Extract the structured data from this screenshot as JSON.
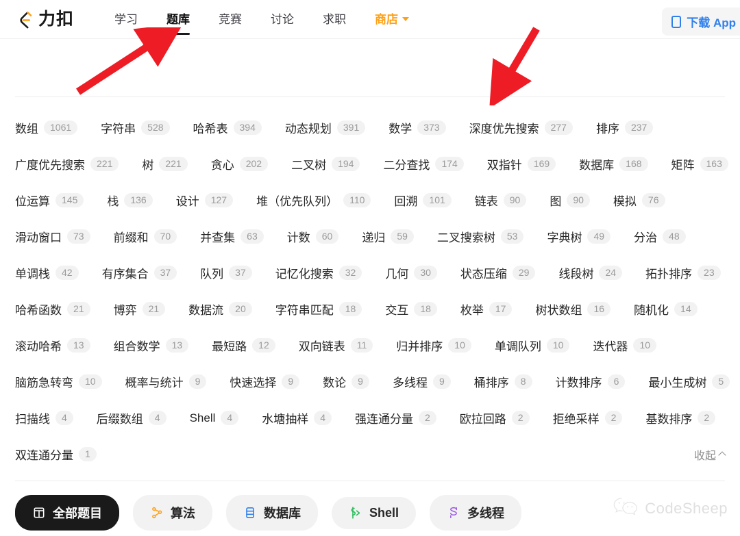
{
  "header": {
    "brand_name": "力扣",
    "brand_logo_icon": "leetcode-logo-icon",
    "nav": [
      {
        "label": "学习",
        "active": false
      },
      {
        "label": "题库",
        "active": true
      },
      {
        "label": "竞赛",
        "active": false
      },
      {
        "label": "讨论",
        "active": false
      },
      {
        "label": "求职",
        "active": false
      }
    ],
    "shop": {
      "label": "商店",
      "icon": "chevron-down-icon"
    },
    "download": {
      "label": "下载 App",
      "icon": "phone-icon",
      "color": "#2f80ed"
    }
  },
  "tags": {
    "rows": [
      [
        {
          "label": "数组",
          "count": "1061"
        },
        {
          "label": "字符串",
          "count": "528"
        },
        {
          "label": "哈希表",
          "count": "394"
        },
        {
          "label": "动态规划",
          "count": "391"
        },
        {
          "label": "数学",
          "count": "373"
        },
        {
          "label": "深度优先搜索",
          "count": "277"
        },
        {
          "label": "排序",
          "count": "237"
        }
      ],
      [
        {
          "label": "广度优先搜索",
          "count": "221"
        },
        {
          "label": "树",
          "count": "221"
        },
        {
          "label": "贪心",
          "count": "202"
        },
        {
          "label": "二叉树",
          "count": "194"
        },
        {
          "label": "二分查找",
          "count": "174"
        },
        {
          "label": "双指针",
          "count": "169"
        },
        {
          "label": "数据库",
          "count": "168"
        },
        {
          "label": "矩阵",
          "count": "163"
        }
      ],
      [
        {
          "label": "位运算",
          "count": "145"
        },
        {
          "label": "栈",
          "count": "136"
        },
        {
          "label": "设计",
          "count": "127"
        },
        {
          "label": "堆（优先队列）",
          "count": "110"
        },
        {
          "label": "回溯",
          "count": "101"
        },
        {
          "label": "链表",
          "count": "90"
        },
        {
          "label": "图",
          "count": "90"
        },
        {
          "label": "模拟",
          "count": "76"
        }
      ],
      [
        {
          "label": "滑动窗口",
          "count": "73"
        },
        {
          "label": "前缀和",
          "count": "70"
        },
        {
          "label": "并查集",
          "count": "63"
        },
        {
          "label": "计数",
          "count": "60"
        },
        {
          "label": "递归",
          "count": "59"
        },
        {
          "label": "二叉搜索树",
          "count": "53"
        },
        {
          "label": "字典树",
          "count": "49"
        },
        {
          "label": "分治",
          "count": "48"
        }
      ],
      [
        {
          "label": "单调栈",
          "count": "42"
        },
        {
          "label": "有序集合",
          "count": "37"
        },
        {
          "label": "队列",
          "count": "37"
        },
        {
          "label": "记忆化搜索",
          "count": "32"
        },
        {
          "label": "几何",
          "count": "30"
        },
        {
          "label": "状态压缩",
          "count": "29"
        },
        {
          "label": "线段树",
          "count": "24"
        },
        {
          "label": "拓扑排序",
          "count": "23"
        }
      ],
      [
        {
          "label": "哈希函数",
          "count": "21"
        },
        {
          "label": "博弈",
          "count": "21"
        },
        {
          "label": "数据流",
          "count": "20"
        },
        {
          "label": "字符串匹配",
          "count": "18"
        },
        {
          "label": "交互",
          "count": "18"
        },
        {
          "label": "枚举",
          "count": "17"
        },
        {
          "label": "树状数组",
          "count": "16"
        },
        {
          "label": "随机化",
          "count": "14"
        }
      ],
      [
        {
          "label": "滚动哈希",
          "count": "13"
        },
        {
          "label": "组合数学",
          "count": "13"
        },
        {
          "label": "最短路",
          "count": "12"
        },
        {
          "label": "双向链表",
          "count": "11"
        },
        {
          "label": "归并排序",
          "count": "10"
        },
        {
          "label": "单调队列",
          "count": "10"
        },
        {
          "label": "迭代器",
          "count": "10"
        }
      ],
      [
        {
          "label": "脑筋急转弯",
          "count": "10"
        },
        {
          "label": "概率与统计",
          "count": "9"
        },
        {
          "label": "快速选择",
          "count": "9"
        },
        {
          "label": "数论",
          "count": "9"
        },
        {
          "label": "多线程",
          "count": "9"
        },
        {
          "label": "桶排序",
          "count": "8"
        },
        {
          "label": "计数排序",
          "count": "6"
        },
        {
          "label": "最小生成树",
          "count": "5"
        }
      ],
      [
        {
          "label": "扫描线",
          "count": "4"
        },
        {
          "label": "后缀数组",
          "count": "4"
        },
        {
          "label": "Shell",
          "count": "4"
        },
        {
          "label": "水塘抽样",
          "count": "4"
        },
        {
          "label": "强连通分量",
          "count": "2"
        },
        {
          "label": "欧拉回路",
          "count": "2"
        },
        {
          "label": "拒绝采样",
          "count": "2"
        },
        {
          "label": "基数排序",
          "count": "2"
        }
      ],
      [
        {
          "label": "双连通分量",
          "count": "1"
        }
      ]
    ],
    "collapse": {
      "label": "收起",
      "icon": "chevron-up-icon"
    }
  },
  "filters": [
    {
      "label": "全部题目",
      "icon": "all-problems-icon",
      "active": true,
      "icon_color": "#ffffff"
    },
    {
      "label": "算法",
      "icon": "algorithms-icon",
      "active": false,
      "icon_color": "#ffa116"
    },
    {
      "label": "数据库",
      "icon": "database-icon",
      "active": false,
      "icon_color": "#2f80ed"
    },
    {
      "label": "Shell",
      "icon": "shell-icon",
      "active": false,
      "icon_color": "#2cbb5d"
    },
    {
      "label": "多线程",
      "icon": "concurrency-icon",
      "active": false,
      "icon_color": "#9b5de5"
    }
  ],
  "watermark": {
    "text": "CodeSheep",
    "icon": "wechat-icon"
  },
  "annotations": {
    "arrow_color": "#ee1c25",
    "arrow_targets": [
      "题库",
      "深度优先搜索"
    ]
  }
}
